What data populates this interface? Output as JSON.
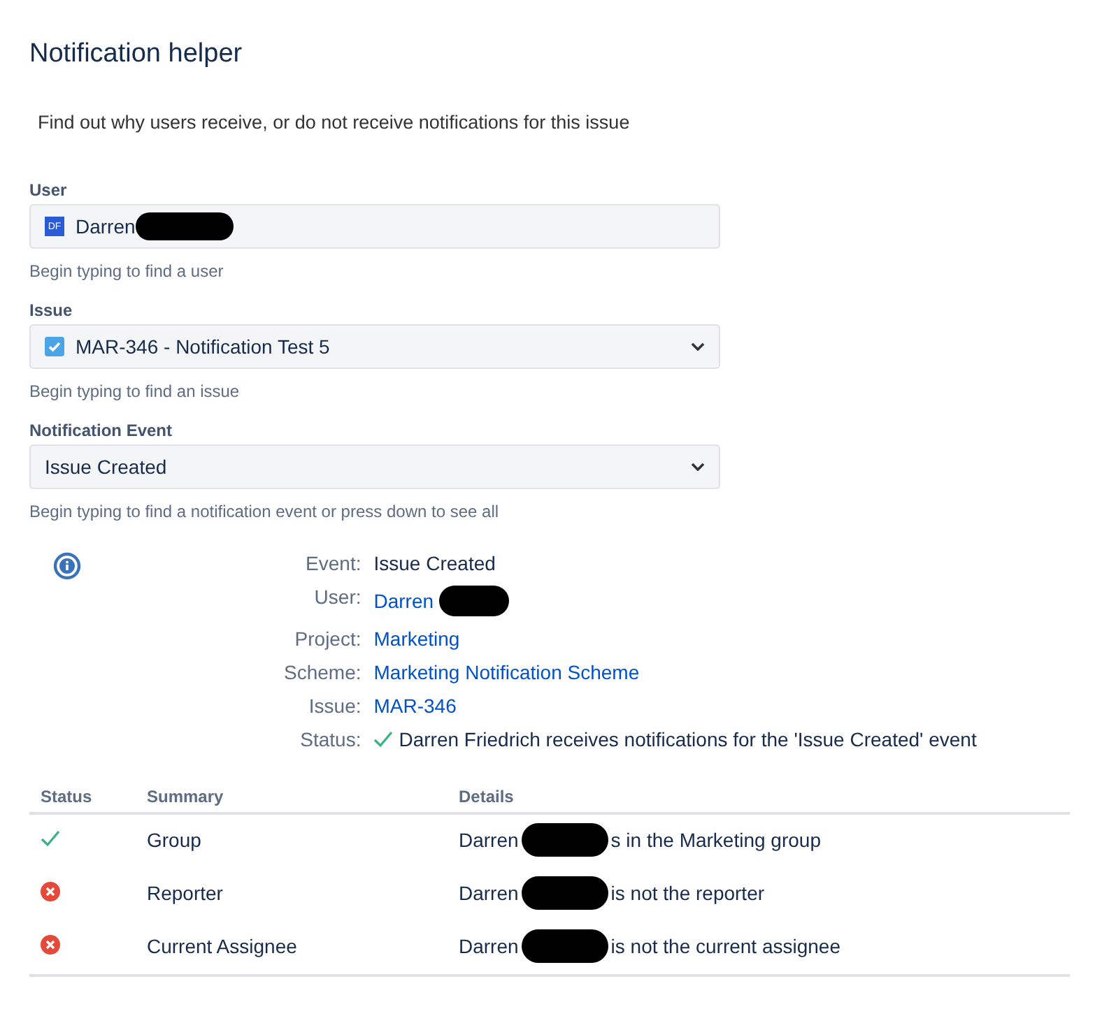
{
  "title": "Notification helper",
  "description": "Find out why users receive, or do not receive notifications for this issue",
  "fields": [
    {
      "label": "User",
      "kind": "user",
      "avatar": "DF",
      "value": "Darren",
      "redacted": true,
      "hint": "Begin typing to find a user"
    },
    {
      "label": "Issue",
      "kind": "issue",
      "value": "MAR-346 - Notification Test 5",
      "redacted": false,
      "hint": "Begin typing to find an issue"
    },
    {
      "label": "Notification Event",
      "kind": "select",
      "value": "Issue Created",
      "redacted": false,
      "hint": "Begin typing to find a notification event or press down to see all"
    }
  ],
  "info": [
    {
      "label": "Event:",
      "kind": "text",
      "value": "Issue Created",
      "redacted": false
    },
    {
      "label": "User:",
      "kind": "link",
      "value": "Darren",
      "redacted": true
    },
    {
      "label": "Project:",
      "kind": "link",
      "value": "Marketing",
      "redacted": false
    },
    {
      "label": "Scheme:",
      "kind": "link",
      "value": "Marketing Notification Scheme",
      "redacted": false
    },
    {
      "label": "Issue:",
      "kind": "link",
      "value": "MAR-346",
      "redacted": false
    },
    {
      "label": "Status:",
      "kind": "status",
      "value": "Darren Friedrich receives notifications for the 'Issue Created' event",
      "redacted": false
    }
  ],
  "table": {
    "columns": [
      "Status",
      "Summary",
      "Details"
    ],
    "rows": [
      {
        "passed": true,
        "summary": "Group",
        "details_before": "Darren",
        "details_after": "s in the Marketing group"
      },
      {
        "passed": false,
        "summary": "Reporter",
        "details_before": "Darren",
        "details_after": "is not the reporter"
      },
      {
        "passed": false,
        "summary": "Current Assignee",
        "details_before": "Darren",
        "details_after": "is not the current assignee"
      }
    ]
  }
}
